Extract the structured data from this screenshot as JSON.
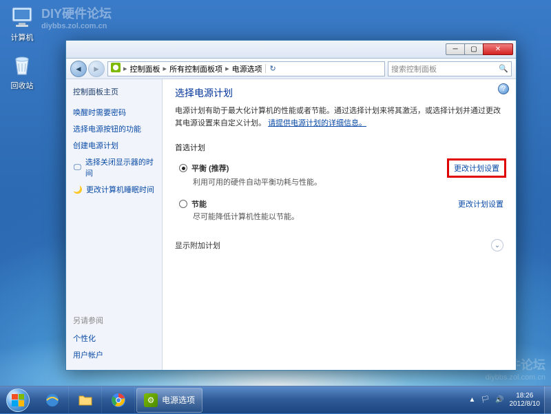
{
  "watermark": {
    "line1": "DIY硬件论坛",
    "line2": "diybbs.zol.com.cn"
  },
  "desktop": {
    "icons": [
      {
        "name": "computer",
        "label": "计算机"
      },
      {
        "name": "recycle-bin",
        "label": "回收站"
      }
    ]
  },
  "window": {
    "breadcrumb": {
      "items": [
        "控制面板",
        "所有控制面板项",
        "电源选项"
      ]
    },
    "search_placeholder": "搜索控制面板",
    "sidebar": {
      "home": "控制面板主页",
      "links": [
        "唤醒时需要密码",
        "选择电源按钮的功能",
        "创建电源计划"
      ],
      "icon_links": [
        "选择关闭显示器的时间",
        "更改计算机睡眠时间"
      ],
      "also_label": "另请参阅",
      "also_links": [
        "个性化",
        "用户帐户"
      ]
    },
    "content": {
      "title": "选择电源计划",
      "desc_a": "电源计划有助于最大化计算机的性能或者节能。通过选择计划来将其激活，或选择计划并通过更改其电源设置来自定义计划。",
      "desc_link": "请提供电源计划的详细信息。",
      "preferred_label": "首选计划",
      "plans": [
        {
          "name": "平衡 (推荐)",
          "sub": "利用可用的硬件自动平衡功耗与性能。",
          "link": "更改计划设置",
          "selected": true,
          "highlight": true
        },
        {
          "name": "节能",
          "sub": "尽可能降低计算机性能以节能。",
          "link": "更改计划设置",
          "selected": false,
          "highlight": false
        }
      ],
      "additional_label": "显示附加计划"
    }
  },
  "taskbar": {
    "task_label": "电源选项",
    "time": "18:26",
    "date": "2012/8/10"
  }
}
